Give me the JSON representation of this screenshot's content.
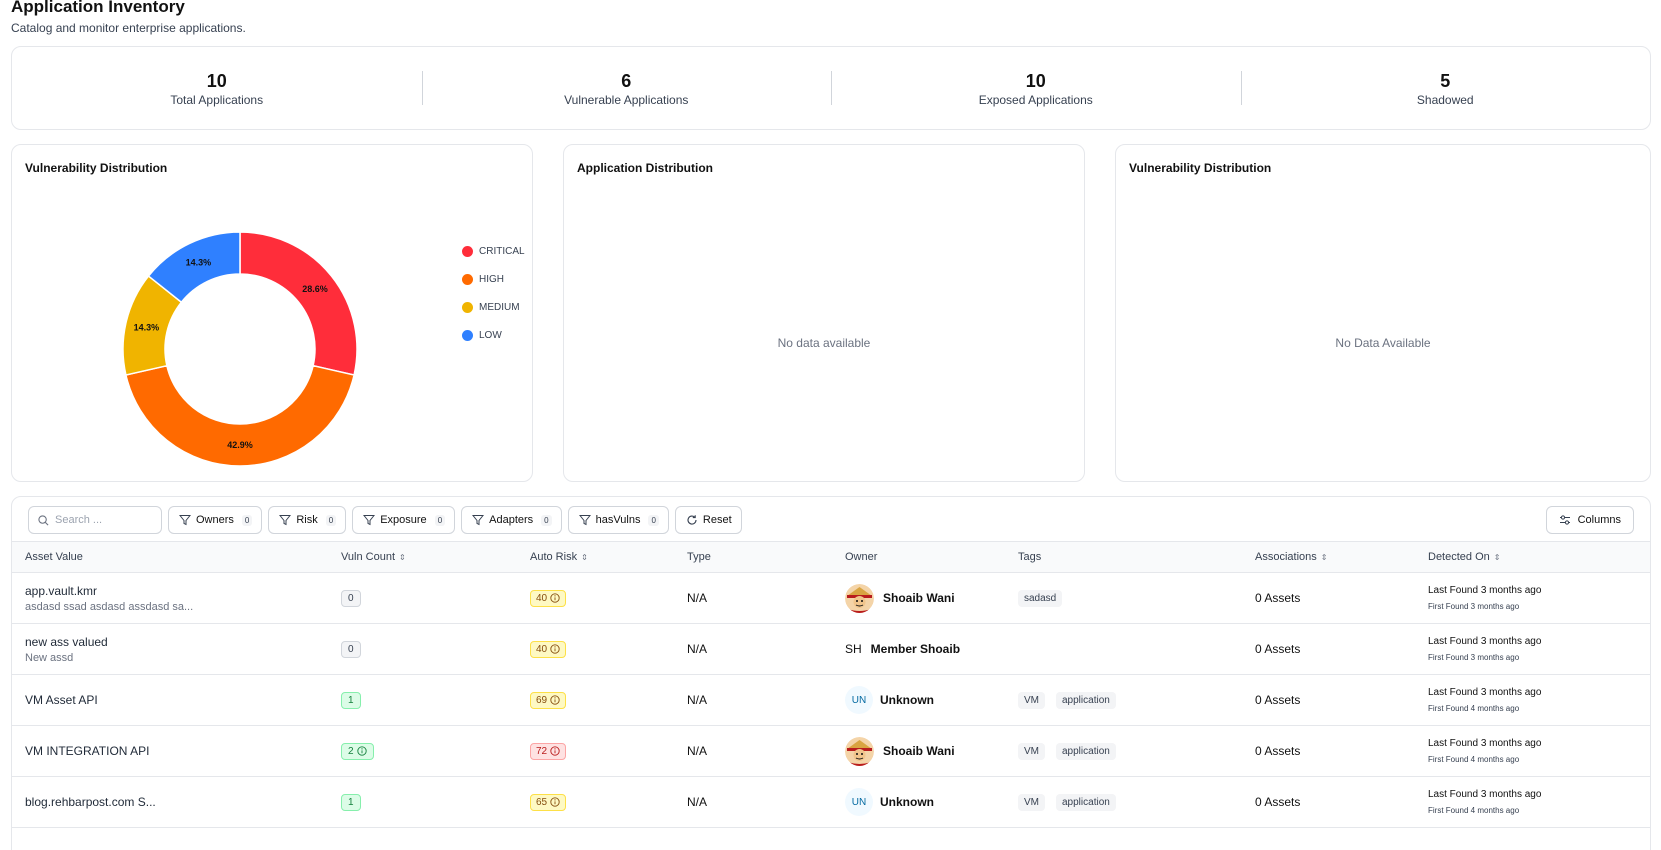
{
  "header": {
    "title": "Application Inventory",
    "subtitle": "Catalog and monitor enterprise applications."
  },
  "stats": [
    {
      "value": "10",
      "label": "Total Applications"
    },
    {
      "value": "6",
      "label": "Vulnerable Applications"
    },
    {
      "value": "10",
      "label": "Exposed Applications"
    },
    {
      "value": "5",
      "label": "Shadowed"
    }
  ],
  "panels": {
    "vuln_chart": {
      "title": "Vulnerability Distribution"
    },
    "app_dist": {
      "title": "Application Distribution",
      "empty": "No data available"
    },
    "vuln_dist2": {
      "title": "Vulnerability Distribution",
      "empty": "No Data Available"
    }
  },
  "chart_data": {
    "type": "pie",
    "donut": true,
    "legend_position": "right",
    "slices": [
      {
        "name": "CRITICAL",
        "value": 28.6,
        "label": "28.6%",
        "color": "#ff2d3a"
      },
      {
        "name": "HIGH",
        "value": 42.9,
        "label": "42.9%",
        "color": "#ff6a00"
      },
      {
        "name": "MEDIUM",
        "value": 14.3,
        "label": "14.3%",
        "color": "#f0b400"
      },
      {
        "name": "LOW",
        "value": 14.3,
        "label": "14.3%",
        "color": "#2f80ff"
      }
    ]
  },
  "toolbar": {
    "search_placeholder": "Search ...",
    "filters": [
      {
        "label": "Owners",
        "count": "0"
      },
      {
        "label": "Risk",
        "count": "0"
      },
      {
        "label": "Exposure",
        "count": "0"
      },
      {
        "label": "Adapters",
        "count": "0"
      },
      {
        "label": "hasVulns",
        "count": "0"
      }
    ],
    "reset_label": "Reset",
    "columns_label": "Columns"
  },
  "table": {
    "columns": {
      "asset": "Asset Value",
      "vuln": "Vuln Count",
      "risk": "Auto Risk",
      "type": "Type",
      "owner": "Owner",
      "tags": "Tags",
      "assoc": "Associations",
      "detected": "Detected On"
    },
    "rows": [
      {
        "name": "app.vault.kmr",
        "desc": "asdasd ssad asdasd assdasd sa...",
        "vuln": "0",
        "risk": "40",
        "type": "N/A",
        "owner": "Shoaib Wani",
        "initials": "",
        "tags": [
          "sadasd"
        ],
        "assoc": "0 Assets",
        "last": "Last Found 3 months ago",
        "first": "First Found 3 months ago"
      },
      {
        "name": "new ass valued",
        "desc": "New assd",
        "vuln": "0",
        "risk": "40",
        "type": "N/A",
        "owner": "Member Shoaib",
        "initials": "SH",
        "tags": [],
        "assoc": "0 Assets",
        "last": "Last Found 3 months ago",
        "first": "First Found 3 months ago"
      },
      {
        "name": "VM Asset API",
        "desc": "",
        "vuln": "1",
        "risk": "69",
        "type": "N/A",
        "owner": "Unknown",
        "initials": "UN",
        "tags": [
          "VM",
          "application"
        ],
        "assoc": "0 Assets",
        "last": "Last Found 3 months ago",
        "first": "First Found 4 months ago"
      },
      {
        "name": "VM INTEGRATION API",
        "desc": "",
        "vuln": "2",
        "risk": "72",
        "type": "N/A",
        "owner": "Shoaib Wani",
        "initials": "",
        "tags": [
          "VM",
          "application"
        ],
        "assoc": "0 Assets",
        "last": "Last Found 3 months ago",
        "first": "First Found 4 months ago"
      },
      {
        "name": "blog.rehbarpost.com S...",
        "desc": "",
        "vuln": "1",
        "risk": "65",
        "type": "N/A",
        "owner": "Unknown",
        "initials": "UN",
        "tags": [
          "VM",
          "application"
        ],
        "assoc": "0 Assets",
        "last": "Last Found 3 months ago",
        "first": "First Found 4 months ago"
      }
    ]
  }
}
